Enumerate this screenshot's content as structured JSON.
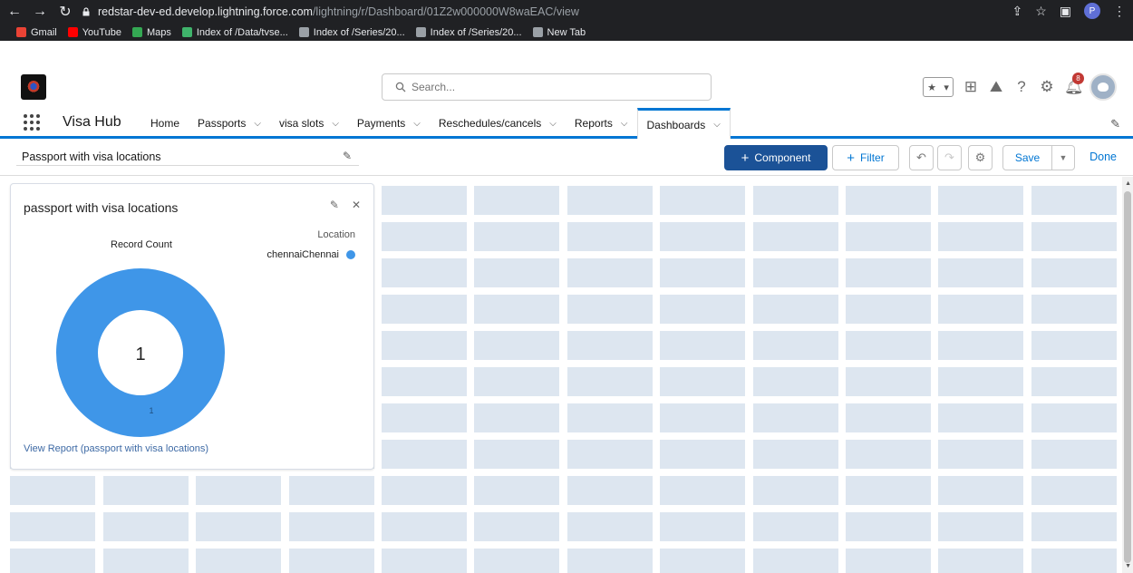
{
  "browser": {
    "url_host": "redstar-dev-ed.develop.lightning.force.com",
    "url_path": "/lightning/r/Dashboard/01Z2w000000W8waEAC/view",
    "profile_initial": "P",
    "bookmarks": [
      {
        "label": "Gmail",
        "color": "#ea4335"
      },
      {
        "label": "YouTube",
        "color": "#ff0000"
      },
      {
        "label": "Maps",
        "color": "#34a853"
      },
      {
        "label": "Index of /Data/tvse...",
        "color": "#3fb36b"
      },
      {
        "label": "Index of /Series/20...",
        "color": "#9aa0a6"
      },
      {
        "label": "Index of /Series/20...",
        "color": "#9aa0a6"
      },
      {
        "label": "New Tab",
        "color": "#9aa0a6"
      }
    ]
  },
  "header": {
    "search_placeholder": "Search...",
    "notification_count": "8"
  },
  "app": {
    "name": "Visa Hub",
    "nav": [
      {
        "label": "Home",
        "has_menu": false,
        "active": false
      },
      {
        "label": "Passports",
        "has_menu": true,
        "active": false
      },
      {
        "label": "visa slots",
        "has_menu": true,
        "active": false
      },
      {
        "label": "Payments",
        "has_menu": true,
        "active": false
      },
      {
        "label": "Reschedules/cancels",
        "has_menu": true,
        "active": false
      },
      {
        "label": "Reports",
        "has_menu": true,
        "active": false
      },
      {
        "label": "Dashboards",
        "has_menu": true,
        "active": true
      }
    ]
  },
  "toolbar": {
    "dashboard_title": "Passport with visa locations",
    "component_label": "Component",
    "filter_label": "Filter",
    "save_label": "Save",
    "done_label": "Done"
  },
  "widget": {
    "title": "passport with visa locations",
    "metric_label": "Record Count",
    "legend_title": "Location",
    "legend_item": "chennaiChennai",
    "total": "1",
    "segment_label": "1",
    "view_report": "View Report (passport with visa locations)",
    "chart_data": {
      "type": "pie",
      "categories": [
        "chennaiChennai"
      ],
      "values": [
        1
      ],
      "colors": [
        "#3f96e8"
      ]
    }
  }
}
